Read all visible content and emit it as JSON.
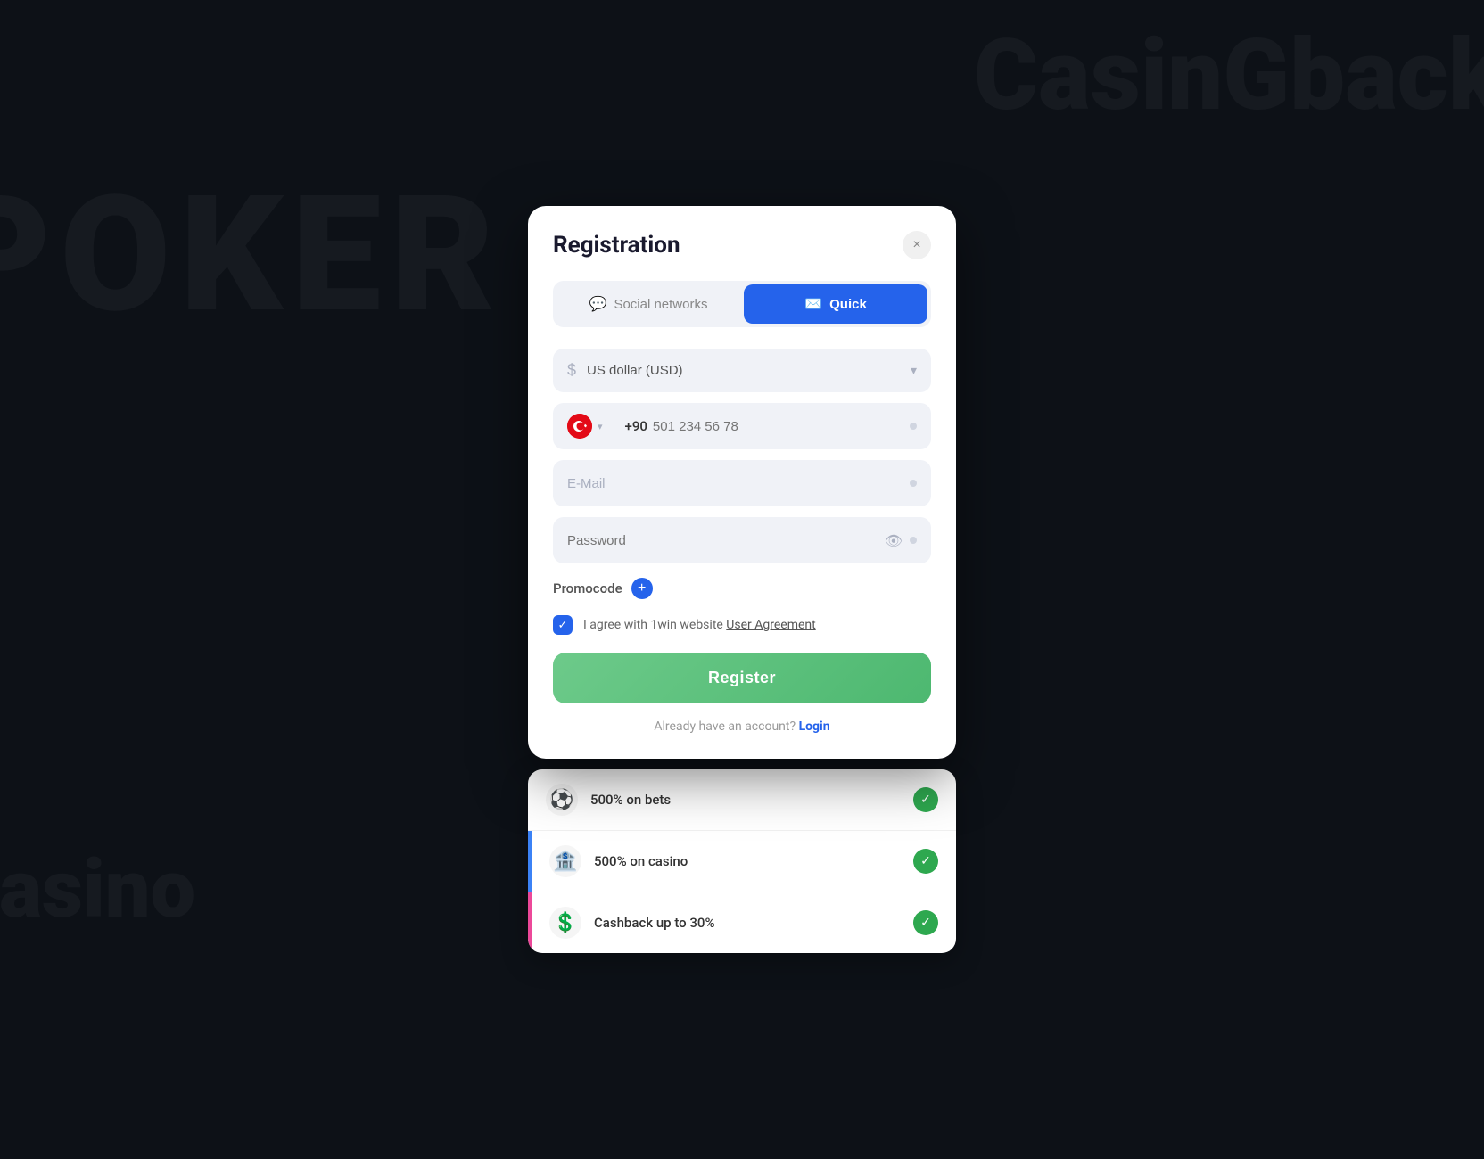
{
  "background": {
    "poker_text": "POKER",
    "casino_text": "Casino",
    "top_right_text": "CasinGback"
  },
  "modal": {
    "title": "Registration",
    "close_label": "×",
    "tabs": [
      {
        "id": "social",
        "label": "Social networks",
        "icon": "💬",
        "active": false
      },
      {
        "id": "quick",
        "label": "Quick",
        "icon": "✉️",
        "active": true
      }
    ],
    "currency": {
      "placeholder": "US dollar (USD)",
      "icon": "$"
    },
    "phone": {
      "country_code": "+90",
      "placeholder": "501 234 56 78",
      "flag": "🇹🇷"
    },
    "email": {
      "placeholder": "E-Mail"
    },
    "password": {
      "placeholder": "Password"
    },
    "promocode": {
      "label": "Promocode",
      "add_label": "+"
    },
    "agreement": {
      "text": "I agree with 1win website ",
      "link_text": "User Agreement"
    },
    "register_button": "Register",
    "login_prompt": "Already have an account? ",
    "login_link": "Login"
  },
  "bonus_items": [
    {
      "icon": "⚽",
      "label": "500% on bets",
      "checked": true
    },
    {
      "icon": "🏦",
      "label": "500% on casino",
      "checked": true
    },
    {
      "icon": "💲",
      "label": "Cashback up to 30%",
      "checked": true
    }
  ]
}
